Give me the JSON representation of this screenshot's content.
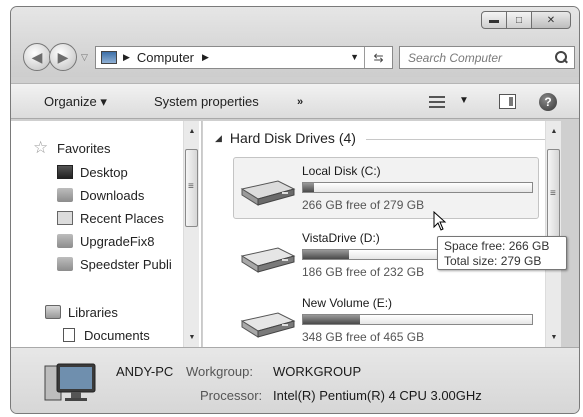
{
  "window": {
    "caption_buttons": [
      "minimize",
      "maximize",
      "close"
    ]
  },
  "address_bar": {
    "icon": "computer-icon",
    "path": "Computer"
  },
  "search": {
    "placeholder": "Search Computer"
  },
  "toolbar": {
    "organize": "Organize ▾",
    "system_properties": "System properties",
    "more": "»"
  },
  "nav": {
    "favorites_label": "Favorites",
    "favorites": [
      {
        "label": "Desktop",
        "icon": "desktop-icon"
      },
      {
        "label": "Downloads",
        "icon": "downloads-folder-icon"
      },
      {
        "label": "Recent Places",
        "icon": "recent-places-icon"
      },
      {
        "label": "UpgradeFix8",
        "icon": "folder-icon"
      },
      {
        "label": "Speedster Publi",
        "icon": "folder-icon"
      }
    ],
    "libraries_label": "Libraries",
    "libraries": [
      {
        "label": "Documents",
        "icon": "documents-icon"
      }
    ]
  },
  "content": {
    "group_title": "Hard Disk Drives (4)",
    "drives": [
      {
        "name": "Local Disk (C:)",
        "free_text": "266 GB free of 279 GB",
        "used_fraction": 0.05,
        "selected": true
      },
      {
        "name": "VistaDrive (D:)",
        "free_text": "186 GB free of 232 GB",
        "used_fraction": 0.2,
        "selected": false
      },
      {
        "name": "New Volume (E:)",
        "free_text": "348 GB free of 465 GB",
        "used_fraction": 0.25,
        "selected": false
      }
    ]
  },
  "tooltip": {
    "line1": "Space free: 266 GB",
    "line2": "Total size: 279 GB"
  },
  "details": {
    "computer_name": "ANDY-PC",
    "workgroup_label": "Workgroup:",
    "workgroup_value": "WORKGROUP",
    "processor_label": "Processor:",
    "processor_value": "Intel(R) Pentium(R) 4 CPU 3.00GHz"
  },
  "colors": {
    "chrome": "#cfcfcf",
    "selection": "#f2f2f2",
    "bar_fill": "#4a4a4a"
  }
}
